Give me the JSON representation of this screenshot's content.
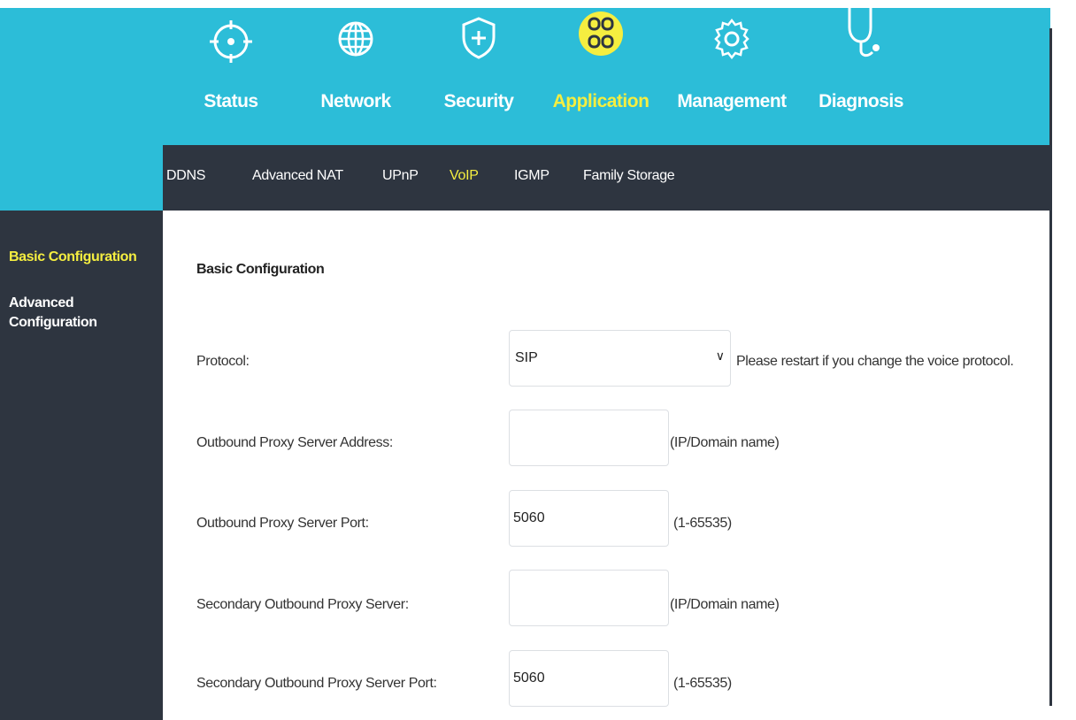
{
  "nav": {
    "items": [
      {
        "label": "Status",
        "icon": "status-icon"
      },
      {
        "label": "Network",
        "icon": "globe-icon"
      },
      {
        "label": "Security",
        "icon": "shield-icon"
      },
      {
        "label": "Application",
        "icon": "apps-icon",
        "active": true
      },
      {
        "label": "Management",
        "icon": "gear-icon"
      },
      {
        "label": "Diagnosis",
        "icon": "stethoscope-icon"
      }
    ]
  },
  "subnav": {
    "items": [
      "DDNS",
      "Advanced NAT",
      "UPnP",
      "VoIP",
      "IGMP",
      "Family Storage"
    ],
    "active": "VoIP"
  },
  "sidebar": {
    "items": [
      "Basic Configuration",
      "Advanced Configuration"
    ],
    "active": "Basic Configuration"
  },
  "main": {
    "section_title": "Basic Configuration",
    "rows": [
      {
        "label": "Protocol:",
        "value": "SIP",
        "hint": "Please restart if you change the voice protocol."
      },
      {
        "label": "Outbound Proxy Server Address:",
        "value": "",
        "hint": "(IP/Domain name)"
      },
      {
        "label": "Outbound Proxy Server Port:",
        "value": "5060",
        "hint": "(1-65535)"
      },
      {
        "label": "Secondary Outbound Proxy Server:",
        "value": "",
        "hint": "(IP/Domain name)"
      },
      {
        "label": "Secondary Outbound Proxy Server Port:",
        "value": "5060",
        "hint": "(1-65535)"
      }
    ]
  },
  "colors": {
    "accent_cyan": "#2cbdd8",
    "dark": "#2e3540",
    "active_yellow": "#f5ee40"
  }
}
